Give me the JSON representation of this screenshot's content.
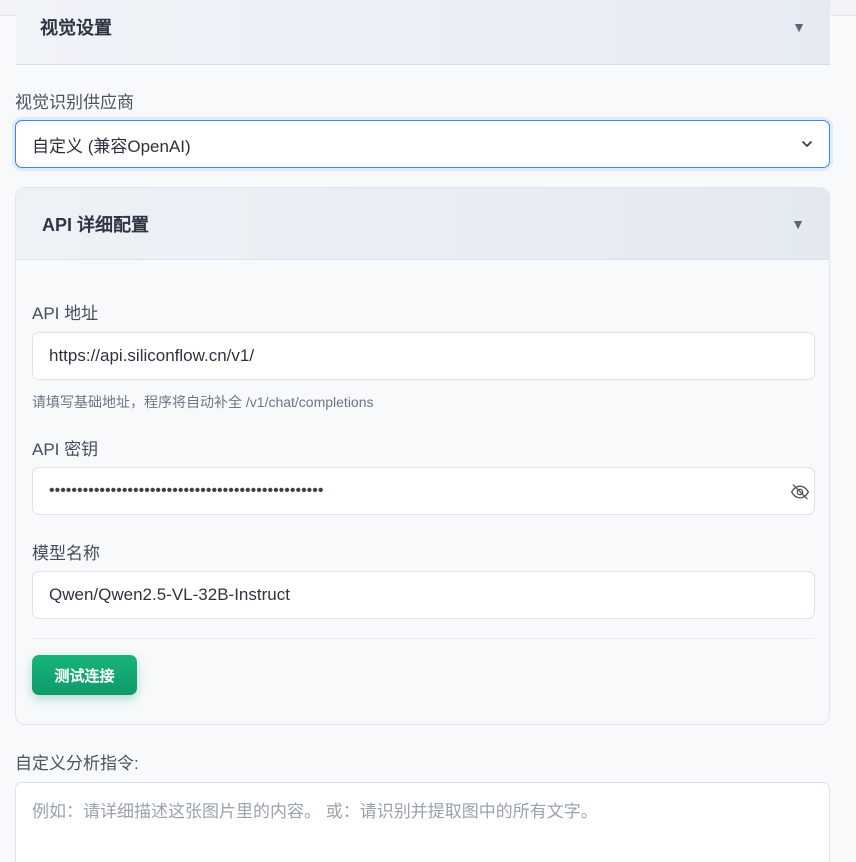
{
  "visual_section": {
    "title": "视觉设置",
    "caret": "▼"
  },
  "provider": {
    "label": "视觉识别供应商",
    "selected": "自定义 (兼容OpenAI)"
  },
  "api_config": {
    "title": "API 详细配置",
    "caret": "▼",
    "address_label": "API 地址",
    "address_value": "https://api.siliconflow.cn/v1/",
    "address_hint": "请填写基础地址，程序将自动补全 /v1/chat/completions",
    "key_label": "API 密钥",
    "key_value": "•••••••••••••••••••••••••••••••••••••••••••••••••",
    "model_label": "模型名称",
    "model_value": "Qwen/Qwen2.5-VL-32B-Instruct",
    "test_button": "测试连接"
  },
  "prompt": {
    "label": "自定义分析指令:",
    "placeholder": "例如：请详细描述这张图片里的内容。 或：请识别并提取图中的所有文字。"
  },
  "icons": {
    "chevron": "chevron-down-icon",
    "eye": "eye-off-icon"
  },
  "colors": {
    "accent": "#3b82f6",
    "button": "#10a56f"
  }
}
